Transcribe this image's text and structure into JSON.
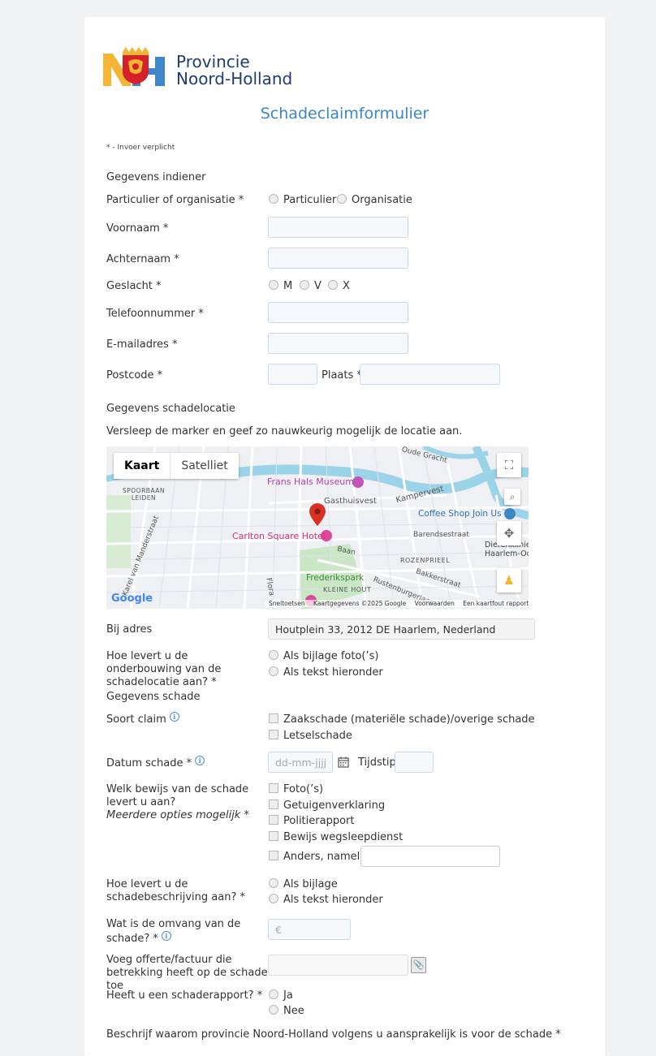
{
  "logo": {
    "line1": "Provincie",
    "line2": "Noord-Holland"
  },
  "title": "Schadeclaimformulier",
  "required_note": "* - Invoer verplicht",
  "section_submitter": "Gegevens indiener",
  "fields": {
    "type_label": "Particulier of organisatie *",
    "type_options": [
      "Particulier",
      "Organisatie"
    ],
    "firstname_label": "Voornaam *",
    "lastname_label": "Achternaam *",
    "gender_label": "Geslacht *",
    "gender_options": [
      "M",
      "V",
      "X"
    ],
    "phone_label": "Telefoonnummer *",
    "email_label": "E-mailadres *",
    "postcode_label": "Postcode *",
    "city_label": "Plaats *"
  },
  "section_location": "Gegevens schadelocatie",
  "location_instruction": "Versleep de marker en geef zo nauwkeurig mogelijk de locatie aan.",
  "map": {
    "tab_map": "Kaart",
    "tab_satellite": "Satelliet",
    "places": {
      "museum": "Frans Hals Museum",
      "hotel": "Carlton Square Hotel",
      "coffee": "Coffee Shop Join Us",
      "park": "Frederikspark",
      "gasthuisvest": "Gasthuisvest",
      "kampervest": "Kampervest",
      "barendsestraat": "Barendsestraat",
      "rozenprieel": "ROZENPRIEEL",
      "kleine_hout": "KLEINE HOUT",
      "spoorbaan": "SPOORBAAN",
      "leiden": "LEIDEN",
      "baan": "Baan",
      "bakkerstraat": "Bakkerstraat",
      "dierenkliniek": "Dierenkliniek",
      "haarlem_oo": "Haarlem-Oo",
      "oude_gracht": "Oude Gracht",
      "karel": "Karel van Manderstraat",
      "rustenburg": "Rustenburgerlaan",
      "flora": "Flora"
    },
    "google": "Google",
    "footer": [
      "Sneltoetsen",
      "Kaartgegevens ©2025 Google",
      "Voorwaarden",
      "Een kaartfout rapporteren"
    ]
  },
  "address_label": "Bij adres",
  "address_value": "Houtplein 33, 2012 DE Haarlem, Nederland",
  "proof_location_label": "Hoe levert u de onderbouwing van de schadelocatie aan? *",
  "proof_location_options": [
    "Als bijlage foto(’s)",
    "Als tekst hieronder"
  ],
  "section_damage": "Gegevens schade",
  "claim_type_label": "Soort claim",
  "claim_type_options": [
    "Zaakschade (materiële schade)/overige schade",
    "Letselschade"
  ],
  "date_label": "Datum schade *",
  "date_placeholder": "dd-mm-jjjj",
  "time_label": "Tijdstip",
  "evidence_label": "Welk bewijs van de schade levert u aan?",
  "evidence_sub": "Meerdere opties mogelijk",
  "evidence_star": " *",
  "evidence_options": [
    "Foto(’s)",
    "Getuigenverklaring",
    "Politierapport",
    "Bewijs wegsleepdienst",
    "Anders, namelijk"
  ],
  "description_label": "Hoe levert u de schadebeschrijving aan? *",
  "description_options": [
    "Als bijlage",
    "Als tekst hieronder"
  ],
  "amount_label": "Wat is de omvang van de schade? *",
  "amount_placeholder": "€",
  "invoice_label": "Voeg offerte/factuur die betrekking heeft op de schade toe",
  "report_label": "Heeft u een schaderapport? *",
  "report_options": [
    "Ja",
    "Nee"
  ],
  "liability_label": "Beschrijf waarom provincie Noord-Holland volgens u aansprakelijk is voor de schade *",
  "icons": {
    "info": "i",
    "calendar": "calendar-icon",
    "paperclip": "paperclip-icon"
  },
  "colors": {
    "accent": "#3b86c8",
    "logo_text": "#1d3d73",
    "logo_yellow": "#f4b434",
    "logo_blue": "#3e86c8",
    "pin": "#d93025"
  }
}
